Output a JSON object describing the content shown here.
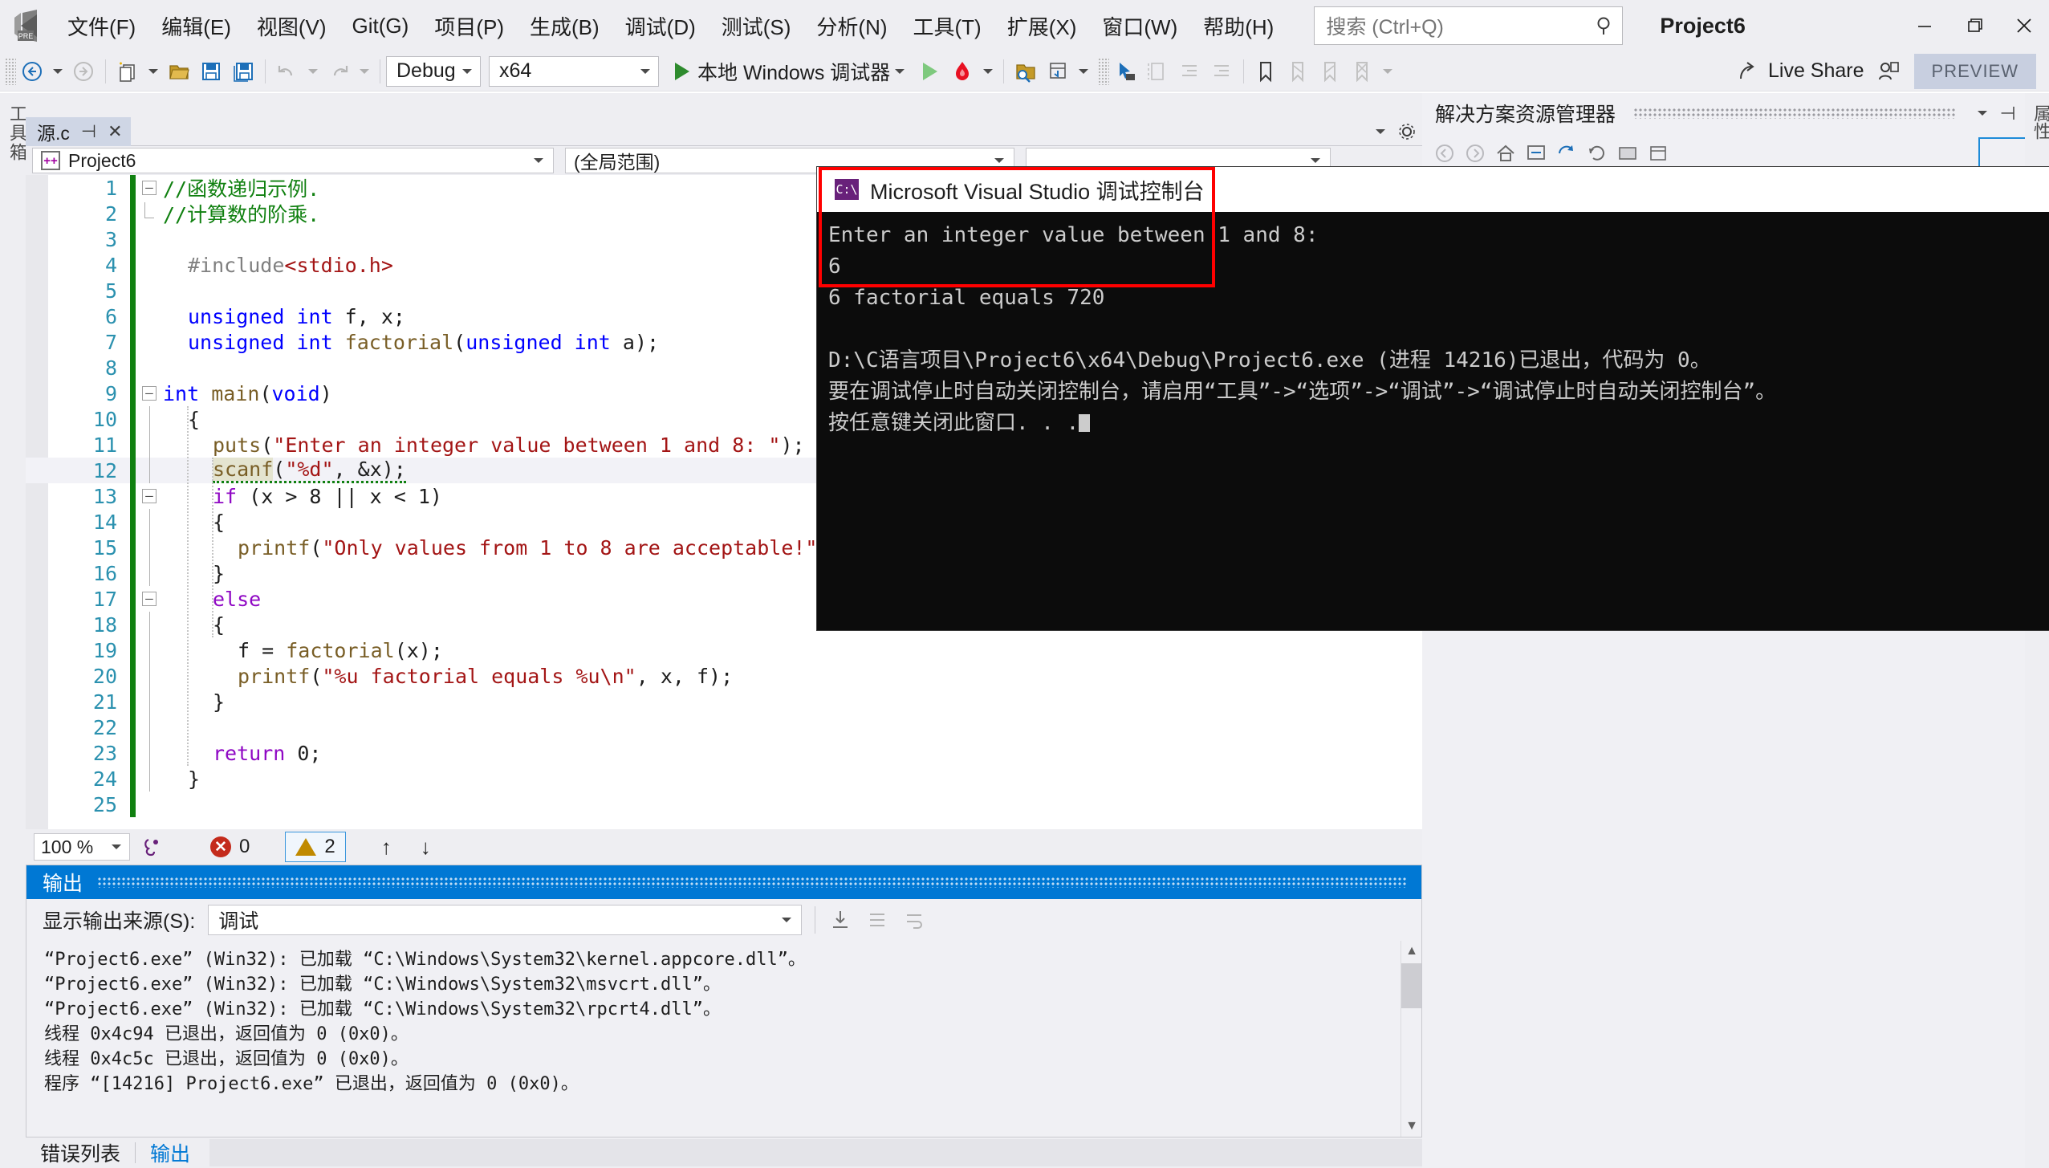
{
  "app": {
    "title": "Project6",
    "logo_label": "PRE"
  },
  "menubar": {
    "items": [
      {
        "label": "文件(F)",
        "name": "menu-file"
      },
      {
        "label": "编辑(E)",
        "name": "menu-edit"
      },
      {
        "label": "视图(V)",
        "name": "menu-view"
      },
      {
        "label": "Git(G)",
        "name": "menu-git"
      },
      {
        "label": "项目(P)",
        "name": "menu-project"
      },
      {
        "label": "生成(B)",
        "name": "menu-build"
      },
      {
        "label": "调试(D)",
        "name": "menu-debug"
      },
      {
        "label": "测试(S)",
        "name": "menu-test"
      },
      {
        "label": "分析(N)",
        "name": "menu-analyze"
      },
      {
        "label": "工具(T)",
        "name": "menu-tools"
      },
      {
        "label": "扩展(X)",
        "name": "menu-extensions"
      },
      {
        "label": "窗口(W)",
        "name": "menu-window"
      },
      {
        "label": "帮助(H)",
        "name": "menu-help"
      }
    ],
    "search_placeholder": "搜索 (Ctrl+Q)",
    "minimize": "—",
    "restore": "❐",
    "close": "✕"
  },
  "toolbar": {
    "config": "Debug",
    "platform": "x64",
    "run_label": "本地 Windows 调试器",
    "live_share": "Live Share",
    "preview_badge": "PREVIEW"
  },
  "left_strip": {
    "label": "工具箱"
  },
  "right_strip": {
    "label": "属性"
  },
  "editor": {
    "tab_label": "源.c",
    "tab_pin": "⊣",
    "tab_close": "✕",
    "scope_left": "Project6",
    "scope_right": "(全局范围)",
    "lines": [
      {
        "n": "1",
        "indent": 0,
        "fold": "minus",
        "segs": [
          {
            "t": "//函数递归示例.",
            "c": "c-com"
          }
        ]
      },
      {
        "n": "2",
        "indent": 0,
        "fold": "bracket",
        "segs": [
          {
            "t": "//计算数的阶乘.",
            "c": "c-com"
          }
        ]
      },
      {
        "n": "3",
        "indent": 0,
        "fold": "",
        "segs": []
      },
      {
        "n": "4",
        "indent": 1,
        "fold": "",
        "segs": [
          {
            "t": "#include",
            "c": "c-pp"
          },
          {
            "t": "<stdio.h>",
            "c": "c-str"
          }
        ]
      },
      {
        "n": "5",
        "indent": 0,
        "fold": "",
        "segs": []
      },
      {
        "n": "6",
        "indent": 1,
        "fold": "",
        "segs": [
          {
            "t": "unsigned int",
            "c": "c-kw"
          },
          {
            "t": " f, x;",
            "c": ""
          }
        ]
      },
      {
        "n": "7",
        "indent": 1,
        "fold": "",
        "segs": [
          {
            "t": "unsigned int",
            "c": "c-kw"
          },
          {
            "t": " ",
            "c": ""
          },
          {
            "t": "factorial",
            "c": "c-fn"
          },
          {
            "t": "(",
            "c": ""
          },
          {
            "t": "unsigned int",
            "c": "c-kw"
          },
          {
            "t": " a);",
            "c": ""
          }
        ]
      },
      {
        "n": "8",
        "indent": 0,
        "fold": "",
        "segs": []
      },
      {
        "n": "9",
        "indent": 0,
        "fold": "minus",
        "segs": [
          {
            "t": "int",
            "c": "c-kw"
          },
          {
            "t": " ",
            "c": ""
          },
          {
            "t": "main",
            "c": "c-fn"
          },
          {
            "t": "(",
            "c": ""
          },
          {
            "t": "void",
            "c": "c-kw"
          },
          {
            "t": ")",
            "c": ""
          }
        ]
      },
      {
        "n": "10",
        "indent": 1,
        "fold": "vline",
        "segs": [
          {
            "t": "{",
            "c": ""
          }
        ]
      },
      {
        "n": "11",
        "indent": 2,
        "fold": "vline",
        "segs": [
          {
            "t": "puts",
            "c": "c-fn"
          },
          {
            "t": "(",
            "c": ""
          },
          {
            "t": "\"Enter an integer value between 1 and 8: \"",
            "c": "c-str"
          },
          {
            "t": ");",
            "c": ""
          }
        ]
      },
      {
        "n": "12",
        "indent": 2,
        "fold": "vline",
        "highlight": true,
        "segs": [
          {
            "t": "scanf",
            "c": "c-fn hl-tok"
          },
          {
            "t": "(",
            "c": ""
          },
          {
            "t": "\"%d\"",
            "c": "c-str"
          },
          {
            "t": ", &x);",
            "c": ""
          }
        ]
      },
      {
        "n": "13",
        "indent": 2,
        "fold": "minus",
        "segs": [
          {
            "t": "if",
            "c": "c-kw2"
          },
          {
            "t": " (x > 8 || x < 1)",
            "c": ""
          }
        ]
      },
      {
        "n": "14",
        "indent": 2,
        "fold": "vline",
        "segs": [
          {
            "t": "{",
            "c": ""
          }
        ]
      },
      {
        "n": "15",
        "indent": 3,
        "fold": "vline",
        "segs": [
          {
            "t": "printf",
            "c": "c-fn"
          },
          {
            "t": "(",
            "c": ""
          },
          {
            "t": "\"Only values from 1 to 8 are acceptable!\"",
            "c": "c-str"
          },
          {
            "t": ");",
            "c": ""
          }
        ]
      },
      {
        "n": "16",
        "indent": 2,
        "fold": "vline",
        "segs": [
          {
            "t": "}",
            "c": ""
          }
        ]
      },
      {
        "n": "17",
        "indent": 2,
        "fold": "minus",
        "segs": [
          {
            "t": "else",
            "c": "c-kw2"
          }
        ]
      },
      {
        "n": "18",
        "indent": 2,
        "fold": "vline",
        "segs": [
          {
            "t": "{",
            "c": ""
          }
        ]
      },
      {
        "n": "19",
        "indent": 3,
        "fold": "vline",
        "segs": [
          {
            "t": "f = ",
            "c": ""
          },
          {
            "t": "factorial",
            "c": "c-fn"
          },
          {
            "t": "(x);",
            "c": ""
          }
        ]
      },
      {
        "n": "20",
        "indent": 3,
        "fold": "vline",
        "segs": [
          {
            "t": "printf",
            "c": "c-fn"
          },
          {
            "t": "(",
            "c": ""
          },
          {
            "t": "\"%u factorial equals %u\\n\"",
            "c": "c-str"
          },
          {
            "t": ", x, f);",
            "c": ""
          }
        ]
      },
      {
        "n": "21",
        "indent": 2,
        "fold": "vline",
        "segs": [
          {
            "t": "}",
            "c": ""
          }
        ]
      },
      {
        "n": "22",
        "indent": 0,
        "fold": "vline",
        "segs": []
      },
      {
        "n": "23",
        "indent": 2,
        "fold": "vline",
        "segs": [
          {
            "t": "return",
            "c": "c-kw2"
          },
          {
            "t": " 0;",
            "c": ""
          }
        ]
      },
      {
        "n": "24",
        "indent": 1,
        "fold": "vline",
        "segs": [
          {
            "t": "}",
            "c": ""
          }
        ]
      },
      {
        "n": "25",
        "indent": 0,
        "fold": "",
        "segs": []
      }
    ]
  },
  "editor_status": {
    "zoom": "100 %",
    "error_count": "0",
    "warning_count": "2",
    "prev_arrow": "↑",
    "next_arrow": "↓"
  },
  "output_panel": {
    "title": "输出",
    "source_label": "显示输出来源(S):",
    "source_value": "调试",
    "lines": [
      "“Project6.exe” (Win32): 已加载 “C:\\Windows\\System32\\kernel.appcore.dll”。",
      "“Project6.exe” (Win32): 已加载 “C:\\Windows\\System32\\msvcrt.dll”。",
      "“Project6.exe” (Win32): 已加载 “C:\\Windows\\System32\\rpcrt4.dll”。",
      "线程 0x4c94 已退出，返回值为 0 (0x0)。",
      "线程 0x4c5c 已退出，返回值为 0 (0x0)。",
      "程序 “[14216] Project6.exe” 已退出，返回值为 0 (0x0)。"
    ]
  },
  "solution_explorer": {
    "title": "解决方案资源管理器",
    "dropdown": "▾",
    "pin": "⊣",
    "close": "✕"
  },
  "console_window": {
    "title": "Microsoft Visual Studio 调试控制台",
    "icon_label": "C:\\",
    "lines": [
      "Enter an integer value between 1 and 8:",
      "6",
      "6 factorial equals 720",
      "",
      "D:\\C语言项目\\Project6\\x64\\Debug\\Project6.exe (进程 14216)已退出，代码为 0。",
      "要在调试停止时自动关闭控制台，请启用“工具”->“选项”->“调试”->“调试停止时自动关闭控制台”。",
      "按任意键关闭此窗口. . ."
    ]
  },
  "bottom_tabs": {
    "items": [
      {
        "label": "错误列表",
        "active": false,
        "name": "bottom-tab-error-list"
      },
      {
        "label": "输出",
        "active": true,
        "name": "bottom-tab-output"
      }
    ]
  },
  "colors": {
    "accent": "#0078d4",
    "menubar_bg": "#eeeef2",
    "console_bg": "#0c0c0c",
    "highlight_red": "#ff0000",
    "comment_green": "#108010",
    "string_red": "#a31515",
    "keyword_blue": "#0000ff"
  }
}
